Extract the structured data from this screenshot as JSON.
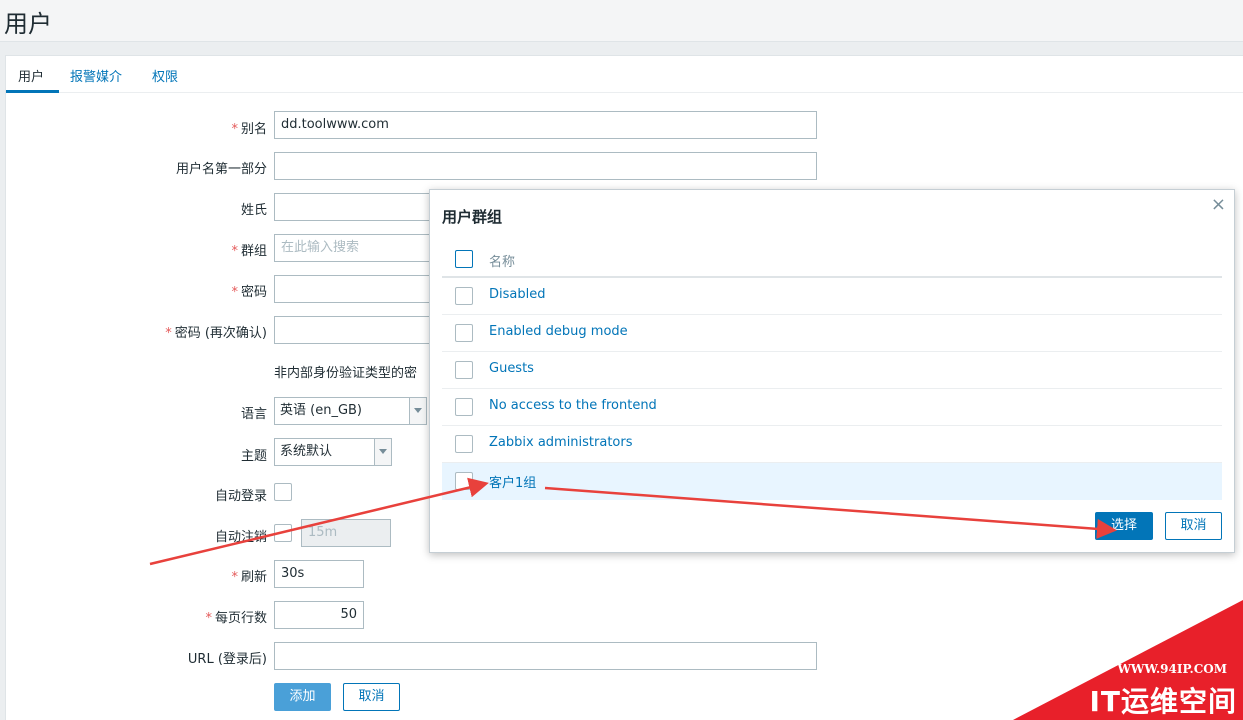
{
  "page": {
    "title": "用户"
  },
  "tabs": [
    {
      "label": "用户"
    },
    {
      "label": "报警媒介"
    },
    {
      "label": "权限"
    }
  ],
  "form": {
    "required_mark": "*",
    "alias": {
      "label": "别名",
      "value": "dd.toolwww.com"
    },
    "name": {
      "label": "用户名第一部分",
      "value": ""
    },
    "surname": {
      "label": "姓氏",
      "value": ""
    },
    "groups": {
      "label": "群组",
      "placeholder": "在此输入搜索"
    },
    "password": {
      "label": "密码",
      "value": ""
    },
    "password_confirm": {
      "label": "密码 (再次确认)",
      "value": ""
    },
    "password_hint": "非内部身份验证类型的密",
    "language": {
      "label": "语言",
      "value": "英语 (en_GB)"
    },
    "theme": {
      "label": "主题",
      "value": "系统默认"
    },
    "autologin": {
      "label": "自动登录"
    },
    "autologout": {
      "label": "自动注销",
      "value": "15m"
    },
    "refresh": {
      "label": "刷新",
      "value": "30s"
    },
    "rows_per_page": {
      "label": "每页行数",
      "value": "50"
    },
    "url": {
      "label": "URL (登录后)",
      "value": ""
    },
    "add_label": "添加",
    "cancel_label": "取消"
  },
  "modal": {
    "title": "用户群组",
    "close_glyph": "×",
    "column_name": "名称",
    "groups": [
      {
        "name": "Disabled"
      },
      {
        "name": "Enabled debug mode"
      },
      {
        "name": "Guests"
      },
      {
        "name": "No access to the frontend"
      },
      {
        "name": "Zabbix administrators"
      },
      {
        "name": "客户1组"
      }
    ],
    "select_label": "选择",
    "cancel_label": "取消"
  },
  "watermark": {
    "url": "WWW.94IP.COM",
    "text": "IT运维空间"
  },
  "colors": {
    "link": "#0275b8",
    "required": "#e45959",
    "annotation": "#e8413c"
  }
}
